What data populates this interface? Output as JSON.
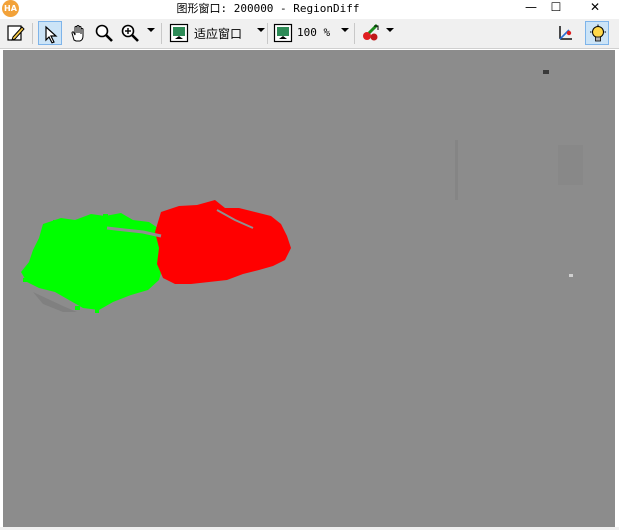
{
  "window": {
    "title": "图形窗口: 200000 - RegionDiff",
    "app_icon_text": "HA",
    "minimize_glyph": "—",
    "maximize_glyph": "☐",
    "close_glyph": "✕"
  },
  "toolbar": {
    "fit_window_label": "适应窗口",
    "zoom_label": "100 %",
    "icons": [
      "edit-icon",
      "pointer-icon",
      "hand-icon",
      "magnifier-icon",
      "zoom-in-icon",
      "fit-window-icon",
      "zoom-percent-icon",
      "color-picker-icon",
      "axes-icon",
      "lightbulb-icon"
    ]
  },
  "colors": {
    "canvas_gray": "#8c8c8c",
    "region_added": "#00ff00",
    "region_removed": "#ff0000",
    "toolbar_bg": "#f0f0f0",
    "active_button": "#cce4f7"
  }
}
